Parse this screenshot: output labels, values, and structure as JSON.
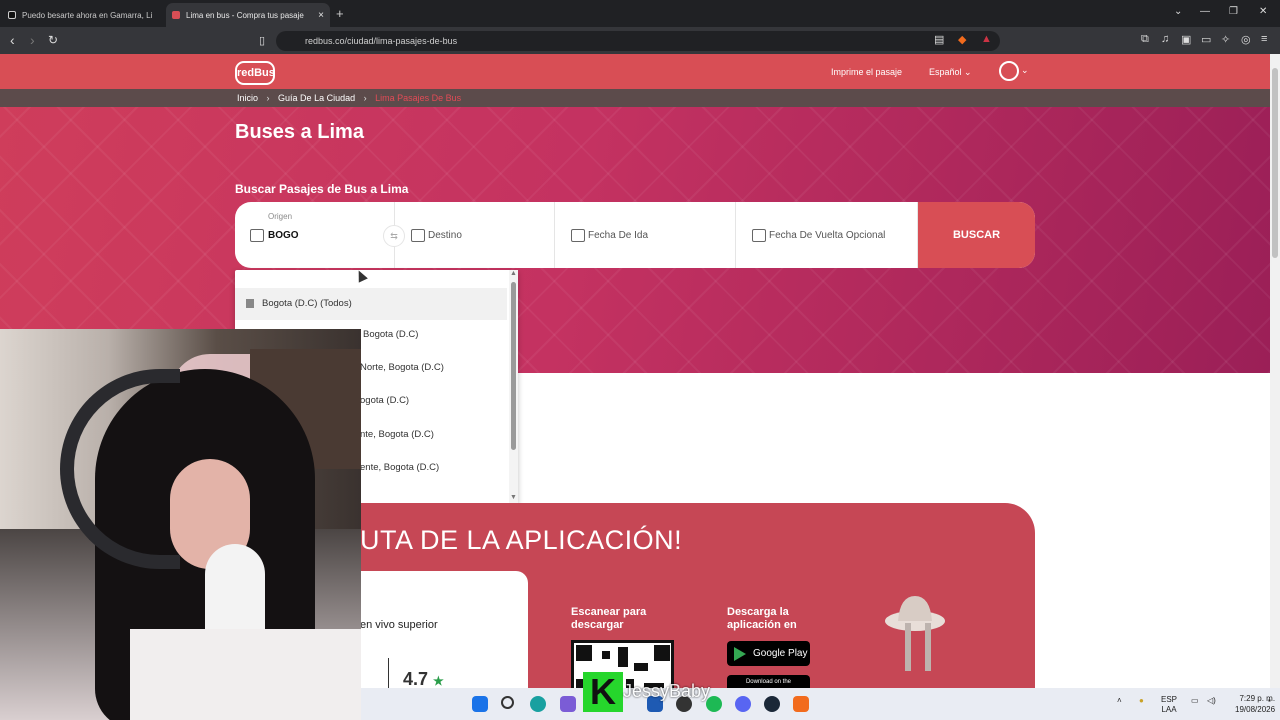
{
  "browser": {
    "tabs": [
      {
        "label": "Puedo besarte ahora en Gamarra, Lin",
        "active": false
      },
      {
        "label": "Lima en bus - Compra tus pasajes",
        "active": true
      }
    ],
    "new_tab": "+",
    "close_tab": "×",
    "url": "redbus.co/ciudad/lima-pasajes-de-bus",
    "window_controls": {
      "menu": "⌄",
      "minimize": "—",
      "restore": "❐",
      "close": "✕"
    }
  },
  "site": {
    "logo": "redBus",
    "header": {
      "print_ticket": "Imprime el pasaje",
      "language": "Español"
    },
    "breadcrumb": [
      "Inicio",
      "Guía De La Ciudad",
      "Lima Pasajes De Bus"
    ],
    "hero": {
      "title": "Buses a Lima",
      "subtitle": "Buscar Pasajes de Bus a Lima"
    },
    "search": {
      "origin_label": "Origen",
      "origin_value": "BOGO",
      "destination_placeholder": "Destino",
      "date_placeholder": "Fecha De Ida",
      "return_placeholder": "Fecha De Vuelta Opcional",
      "button": "BUSCAR"
    },
    "suggestions": [
      "Bogota (D.C) (Todos)",
      "Bogota (D.C)",
      "Norte, Bogota (D.C)",
      "ogota (D.C)",
      "nte, Bogota (D.C)",
      "ente, Bogota (D.C)"
    ],
    "promo": {
      "title": "UTA DE LA APLICACIÓN!",
      "rating_label": "en vivo superior",
      "rating": "4.7",
      "rating_star": "★",
      "scan_label": "Escanear para descargar",
      "download_label": "Descarga la aplicación en",
      "google_play": "Google Play",
      "app_store": "Download on the"
    }
  },
  "overlay": {
    "watermark": "JessyBaby",
    "k_logo": "K"
  },
  "taskbar": {
    "lang": "ESP",
    "lang2": "LAA",
    "time": "7:29 p. m.",
    "date": "19/08/2026"
  },
  "colors": {
    "brand": "#d84e55",
    "hero_start": "#cf3d5b",
    "hero_end": "#9b1f57"
  }
}
